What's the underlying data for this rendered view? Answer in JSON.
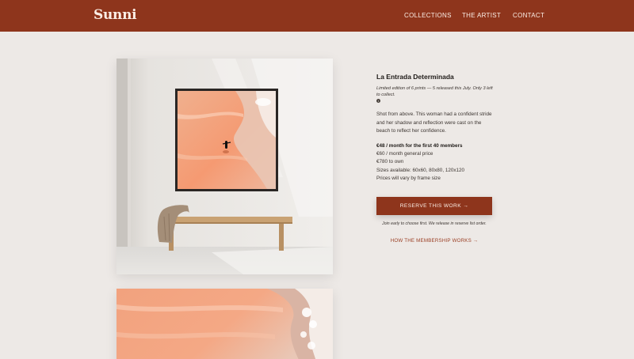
{
  "header": {
    "logo": "Sunni",
    "nav": [
      "COLLECTIONS",
      "THE ARTIST",
      "CONTACT"
    ]
  },
  "product": {
    "title": "La Entrada Determinada",
    "edition": "Limited edition of 6 prints — 5 released this July. Only 3 left to collect.",
    "info_icon": "i",
    "description": "Shot from above. This woman had a confident stride and her shadow and reflection were cast on the beach to reflect her confidence.",
    "price_membership": "€48 / month for the first 40 members",
    "price_general": "€60 / month general price",
    "price_own": "€780 to own",
    "sizes": "Sizes available: 60x60, 80x80, 120x120",
    "frame_note": "Prices will vary by frame size"
  },
  "cta": {
    "reserve_label": "RESERVE THIS WORK →",
    "reserve_note": "Join early to choose first. We release in reserve list order.",
    "membership_link": "HOW THE MEMBERSHIP WORKS →"
  },
  "colors": {
    "brand": "#8e351c",
    "background": "#ede9e6"
  }
}
